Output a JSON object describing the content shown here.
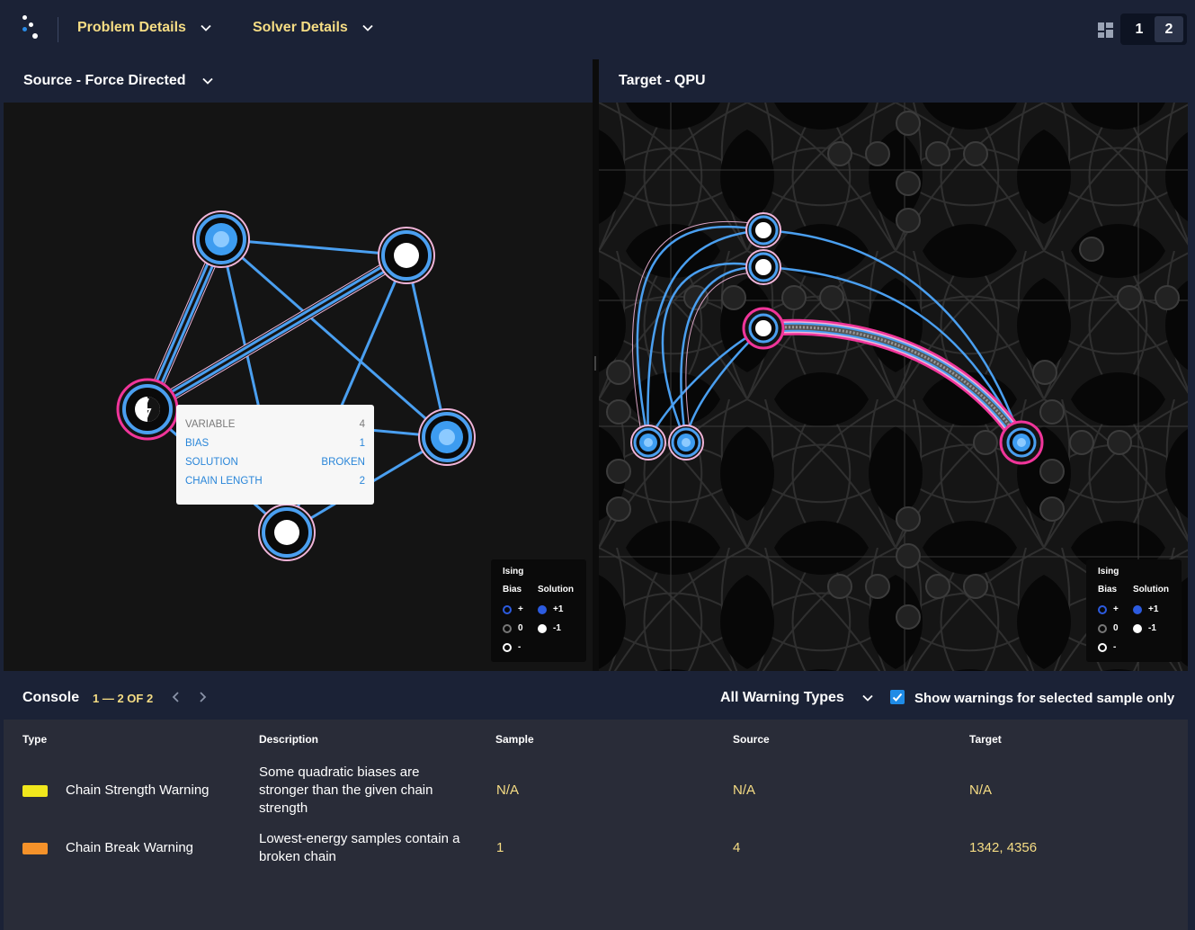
{
  "nav": {
    "menu_problem": "Problem Details",
    "menu_solver": "Solver Details",
    "page_buttons": [
      "1",
      "2"
    ],
    "active_page": "2"
  },
  "source_panel": {
    "title": "Source - Force Directed",
    "tooltip": {
      "rows": [
        {
          "label": "VARIABLE",
          "value": "4"
        },
        {
          "label": "BIAS",
          "value": "1"
        },
        {
          "label": "SOLUTION",
          "value": "BROKEN"
        },
        {
          "label": "CHAIN LENGTH",
          "value": "2"
        }
      ]
    }
  },
  "target_panel": {
    "title": "Target - QPU"
  },
  "legend": {
    "title": "Ising",
    "bias_header": "Bias",
    "solution_header": "Solution",
    "bias_items": [
      "+",
      "0",
      "-"
    ],
    "solution_items": [
      "+1",
      "-1"
    ]
  },
  "console": {
    "title": "Console",
    "count": "1 — 2 OF 2",
    "filter_label": "All Warning Types",
    "checkbox_label": "Show warnings for selected sample only",
    "checkbox_checked": true,
    "columns": [
      "Type",
      "Description",
      "Sample",
      "Source",
      "Target"
    ],
    "rows": [
      {
        "type": "Chain Strength Warning",
        "color": "#f0e71c",
        "description": "Some quadratic biases are stronger than the given chain strength",
        "sample": "N/A",
        "source": "N/A",
        "target": "N/A"
      },
      {
        "type": "Chain Break Warning",
        "color": "#f5922a",
        "description": "Lowest-energy samples contain a broken chain",
        "sample": "1",
        "source": "4",
        "target": "1342, 4356"
      }
    ]
  },
  "colors": {
    "accent_yellow": "#f6dd84",
    "edge_blue": "#4a9ff0",
    "chain_pink": "#f0b4d8",
    "broken_magenta": "#f0359a",
    "header_bg": "#1b2236"
  }
}
